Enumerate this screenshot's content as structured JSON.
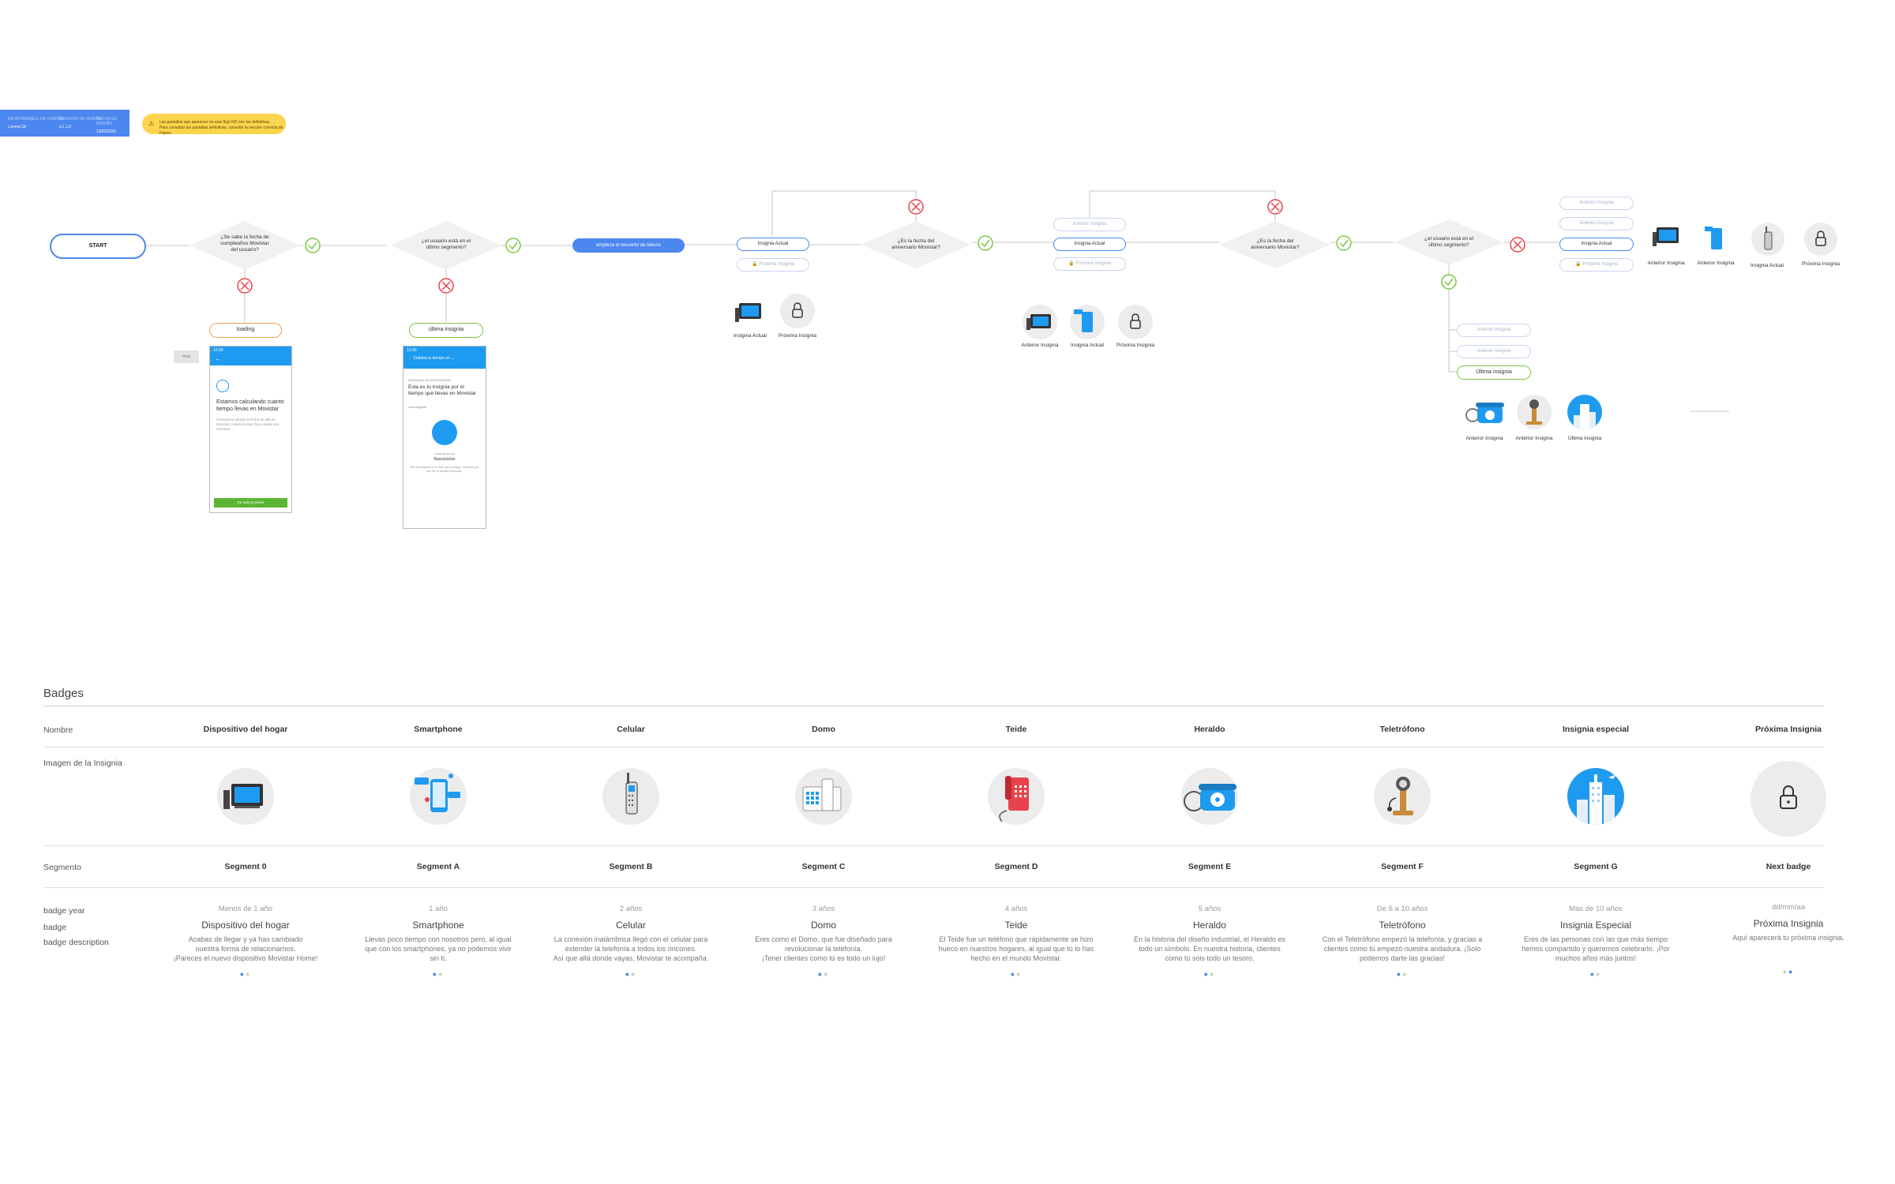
{
  "header": {
    "meta": [
      {
        "label": "RESPONSABLE DE DISEÑO",
        "value": "Lorena Gil"
      },
      {
        "label": "VERSIÓN DE DISEÑO",
        "value": "v.1.1.0"
      },
      {
        "label": "FECHA DE DISEÑO",
        "value": "13/03/2023"
      }
    ],
    "warning": {
      "line1": "Las pantallas que aparecen en este flujo NO son las definitivas.",
      "line2": "Para consultar las pantallas definitivas, consulte la sección correcta de Figma."
    }
  },
  "flow": {
    "start": "START",
    "q1": [
      "¿Se sabe la fecha de",
      "cumpleaños Movistar",
      "del usuario?"
    ],
    "loading": "loading",
    "q2": [
      "¿el usuario está en el",
      "último segmento?"
    ],
    "ultima_top": "última insignia",
    "empieza": "empieza el recuento de tokens",
    "insignia_actual": "Insignia Actual",
    "proxima_insignia": "Próxima Insignia",
    "anterior_insignia": "Anterior Insignia",
    "ultima_insignia": "Última insignia",
    "q3": [
      "¿Es la fecha del",
      "aniversario Movistar?"
    ],
    "q4": [
      "¿Es la fecha del",
      "aniversario Movistar?"
    ],
    "q5": [
      "¿el usuario está en el",
      "último segmento?"
    ],
    "cap_a": [
      "Insignia Actual",
      "Próxima Insignia"
    ],
    "cap_b": [
      "Anterior Insignia",
      "Insignia Actual",
      "Próxima Insignia"
    ],
    "cap_c": [
      "Anterior Insignia",
      "Anterior Insignia",
      "Insignia Actual",
      "Próxima Insignia"
    ],
    "cap_d": [
      "Anterior Insignia",
      "Anterior Insignia",
      "Última insignia"
    ],
    "phone1": {
      "time": "12:00",
      "title": "Estamos calculando cuanto tiempo llevas en Movistar",
      "body": "Calculamos desde la fecha de alta en Movistar, cuánto tiempo has estado con nosotros.",
      "button": "De todo proviene"
    },
    "phone2": {
      "time": "12:00",
      "nav": "Celebra tu tiempo en ...",
      "small": "INSIGNIAS DE ANTIGÜEDAD",
      "title": "Esta es tu insignia por el tiempo que llevas en Movistar",
      "small2": "Las insignias",
      "badge_label": "Insignia actual",
      "badge_name": "Rascacielos",
      "body": "Hemos llegado a lo más alto contigo. Gracias por ser de la familia Movistar."
    },
    "side_tag": "Hola"
  },
  "table": {
    "title": "Badges",
    "row_labels": {
      "nombre": "Nombre",
      "imagen": "Imagen de la Insignia",
      "segmento": "Segmento",
      "year": "badge year",
      "badge": "badge",
      "desc": "badge description"
    },
    "columns": [
      {
        "nombre": "Dispositivo del hogar",
        "icon": "home-device-icon",
        "segment": "Segment 0",
        "year": "Menos de 1 año",
        "badge": "Dispositivo del hogar",
        "desc": [
          "Acabas de llegar y ya has cambiado",
          "nuestra forma de relacionarnos.",
          "¡Pareces el nuevo dispositivo Movistar Home!"
        ]
      },
      {
        "nombre": "Smartphone",
        "icon": "smartphone-icon",
        "segment": "Segment A",
        "year": "1 año",
        "badge": "Smartphone",
        "desc": [
          "Llevas poco tiempo con nosotros pero, al igual",
          "que con los smartphones, ya no podemos vivir",
          "sin ti."
        ]
      },
      {
        "nombre": "Celular",
        "icon": "cellular-icon",
        "segment": "Segment B",
        "year": "2 años",
        "badge": "Celular",
        "desc": [
          "La conexión inalámbrica llegó con el celular para",
          "extender la telefonía a todos los rincones.",
          "Así que allá donde vayas, Movistar te acompaña."
        ]
      },
      {
        "nombre": "Domo",
        "icon": "domo-phone-icon",
        "segment": "Segment C",
        "year": "3 años",
        "badge": "Domo",
        "desc": [
          "Eres como el Domo, que fue diseñado para",
          "revolucionar la telefonía.",
          "¡Tener clientes como tú es todo un lujo!"
        ]
      },
      {
        "nombre": "Teide",
        "icon": "teide-phone-icon",
        "segment": "Segment D",
        "year": "4 años",
        "badge": "Teide",
        "desc": [
          "El Teide fue un teléfono que rápidamente se hizo",
          "hueco en nuestros hogares, al igual que tú lo has",
          "hecho en el mundo Movistar."
        ]
      },
      {
        "nombre": "Heraldo",
        "icon": "heraldo-phone-icon",
        "segment": "Segment E",
        "year": "5 años",
        "badge": "Heraldo",
        "desc": [
          "En la historia del diseño industrial, el Heraldo es",
          "todo un símbolo. En nuestra historia, clientes",
          "como tú sois todo un tesoro."
        ]
      },
      {
        "nombre": "Teletrófono",
        "icon": "teletrofono-icon",
        "segment": "Segment F",
        "year": "De 6 a 10 años",
        "badge": "Teletrófono",
        "desc": [
          "Con el Teletrófono empezó la telefonía, y gracias a",
          "clientes como tú empezó nuestra andadura. ¡Solo",
          "podemos darte las gracias!"
        ]
      },
      {
        "nombre": "Insignia especial",
        "icon": "skyscraper-icon",
        "segment": "Segment G",
        "year": "Más de 10 años",
        "badge": "Insignia Especial",
        "desc": [
          "Eres de las personas con las que más tiempo",
          "hemos compartido y queremos celebrarlo. ¡Por",
          "muchos años más juntos!"
        ]
      },
      {
        "nombre": "Próxima Insignia",
        "icon": "lock-icon",
        "segment": "Next badge",
        "year": "dd/mm/aa",
        "badge": "Próxima Insignia",
        "desc": [
          "Aquí aparecerá tu próxima insignia."
        ]
      }
    ]
  },
  "colors": {
    "blue": "#4c87ef",
    "green": "#7cc840",
    "red": "#e8434b",
    "orange": "#f4a14a",
    "yellow": "#fcd44d",
    "sky": "#1e9bf0"
  }
}
